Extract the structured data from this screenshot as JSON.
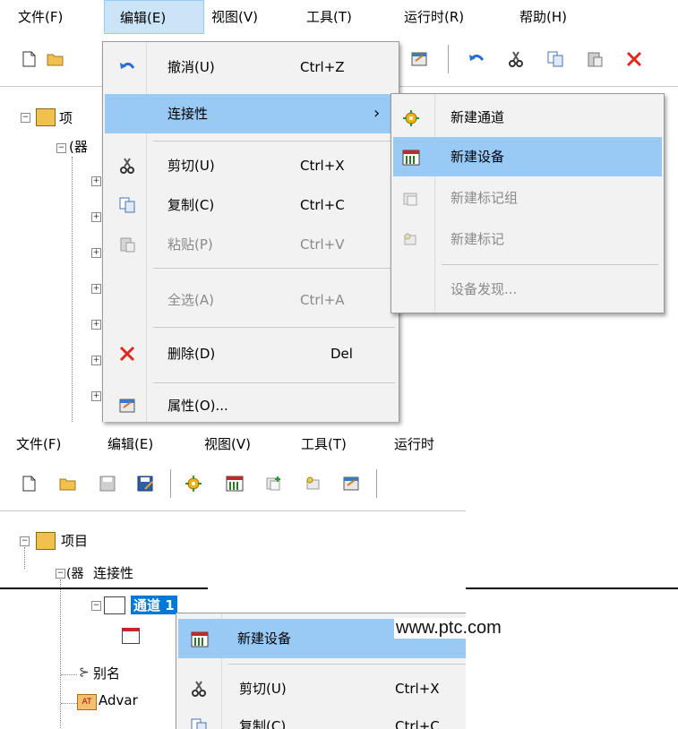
{
  "top": {
    "menubar": [
      "文件(F)",
      "编辑(E)",
      "视图(V)",
      "工具(T)",
      "运行时(R)",
      "帮助(H)"
    ],
    "tree_partial": [
      "项",
      "(器"
    ],
    "edit_menu": [
      {
        "label": "撤消(U)",
        "shortcut": "Ctrl+Z",
        "icon": "undo-icon",
        "disabled": false
      },
      {
        "label": "连接性",
        "shortcut": "›",
        "icon": "",
        "disabled": false,
        "highlighted": true
      },
      {
        "label": "剪切(U)",
        "shortcut": "Ctrl+X",
        "icon": "scissors-icon",
        "disabled": false
      },
      {
        "label": "复制(C)",
        "shortcut": "Ctrl+C",
        "icon": "copy-icon",
        "disabled": false
      },
      {
        "label": "粘贴(P)",
        "shortcut": "Ctrl+V",
        "icon": "paste-icon",
        "disabled": true
      },
      {
        "label": "全选(A)",
        "shortcut": "Ctrl+A",
        "icon": "",
        "disabled": true
      },
      {
        "label": "删除(D)",
        "shortcut": "Del",
        "icon": "delete-icon",
        "disabled": false
      },
      {
        "label": "属性(O)...",
        "shortcut": "",
        "icon": "properties-icon",
        "disabled": false
      }
    ],
    "submenu": [
      {
        "label": "新建通道",
        "icon": "new-channel-icon",
        "disabled": false
      },
      {
        "label": "新建设备",
        "icon": "new-device-icon",
        "disabled": false,
        "highlighted": true
      },
      {
        "label": "新建标记组",
        "icon": "new-tag-group-icon",
        "disabled": true
      },
      {
        "label": "新建标记",
        "icon": "new-tag-icon",
        "disabled": true
      },
      {
        "label": "设备发现...",
        "icon": "",
        "disabled": true
      }
    ]
  },
  "bottom": {
    "menubar": [
      "文件(F)",
      "编辑(E)",
      "视图(V)",
      "工具(T)",
      "运行时"
    ],
    "tree": {
      "project": "项目",
      "connectivity": "连接性",
      "channel": "通道 1",
      "alias": "别名",
      "advanced": "Advar"
    },
    "website": "www.ptc.com",
    "context_menu": [
      {
        "label": "新建设备",
        "shortcut": "",
        "icon": "new-device-icon",
        "highlighted": true
      },
      {
        "label": "剪切(U)",
        "shortcut": "Ctrl+X",
        "icon": "scissors-icon"
      },
      {
        "label": "复制(C)",
        "shortcut": "Ctrl+C",
        "icon": "copy-icon"
      }
    ]
  },
  "colors": {
    "highlight": "#99c9f5",
    "menu_bg": "#f2f2f2",
    "selection": "#0078d7",
    "delete_red": "#e0281c"
  }
}
